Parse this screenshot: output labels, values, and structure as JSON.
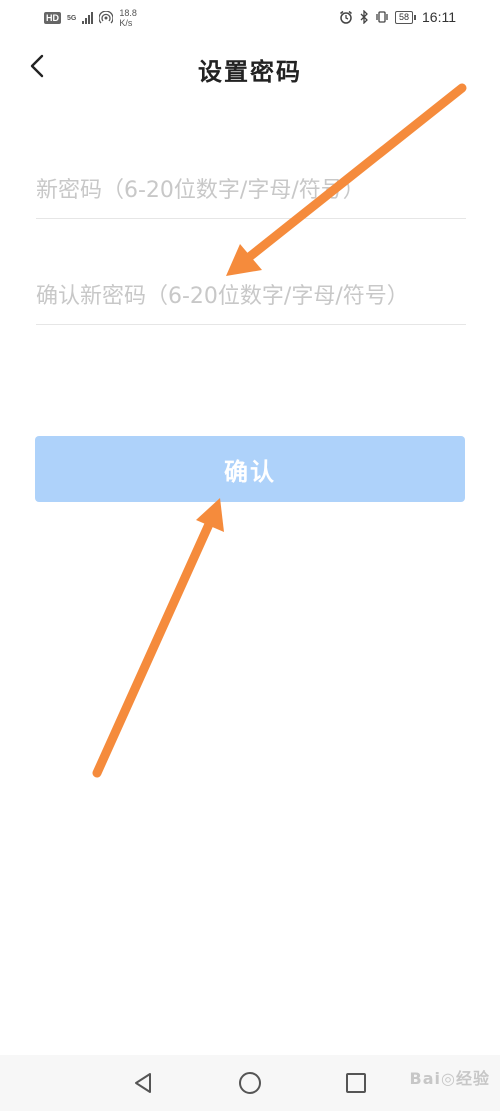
{
  "status_bar": {
    "hd_label": "HD",
    "network_label": "5G",
    "speed_value": "18.8",
    "speed_unit": "K/s",
    "battery_level": "58",
    "time": "16:11"
  },
  "header": {
    "title": "设置密码"
  },
  "form": {
    "new_password_placeholder": "新密码（6-20位数字/字母/符号）",
    "confirm_password_placeholder": "确认新密码（6-20位数字/字母/符号）",
    "confirm_button_label": "确认"
  },
  "watermark": {
    "text": "Bai◎经验"
  },
  "colors": {
    "button_bg": "#aed2fa",
    "annotation_arrow": "#f58b3c"
  }
}
